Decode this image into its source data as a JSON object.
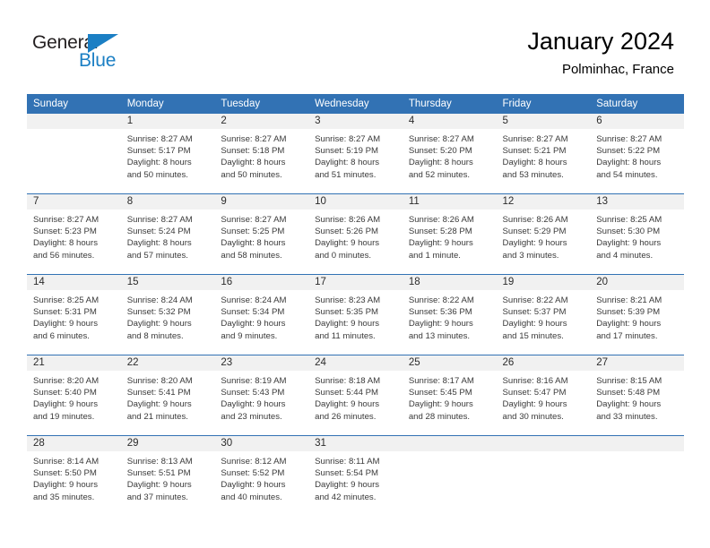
{
  "brand": {
    "name_part1": "General",
    "name_part2": "Blue",
    "accent_color": "#1b7fc4"
  },
  "header": {
    "title": "January 2024",
    "subtitle": "Polminhac, France"
  },
  "calendar": {
    "header_color": "#3272b4",
    "daynum_band_color": "#f1f1f1",
    "weekday_headers": [
      "Sunday",
      "Monday",
      "Tuesday",
      "Wednesday",
      "Thursday",
      "Friday",
      "Saturday"
    ],
    "weeks": [
      [
        {
          "day": "",
          "sunrise": "",
          "sunset": "",
          "daylight_line1": "",
          "daylight_line2": ""
        },
        {
          "day": "1",
          "sunrise": "Sunrise: 8:27 AM",
          "sunset": "Sunset: 5:17 PM",
          "daylight_line1": "Daylight: 8 hours",
          "daylight_line2": "and 50 minutes."
        },
        {
          "day": "2",
          "sunrise": "Sunrise: 8:27 AM",
          "sunset": "Sunset: 5:18 PM",
          "daylight_line1": "Daylight: 8 hours",
          "daylight_line2": "and 50 minutes."
        },
        {
          "day": "3",
          "sunrise": "Sunrise: 8:27 AM",
          "sunset": "Sunset: 5:19 PM",
          "daylight_line1": "Daylight: 8 hours",
          "daylight_line2": "and 51 minutes."
        },
        {
          "day": "4",
          "sunrise": "Sunrise: 8:27 AM",
          "sunset": "Sunset: 5:20 PM",
          "daylight_line1": "Daylight: 8 hours",
          "daylight_line2": "and 52 minutes."
        },
        {
          "day": "5",
          "sunrise": "Sunrise: 8:27 AM",
          "sunset": "Sunset: 5:21 PM",
          "daylight_line1": "Daylight: 8 hours",
          "daylight_line2": "and 53 minutes."
        },
        {
          "day": "6",
          "sunrise": "Sunrise: 8:27 AM",
          "sunset": "Sunset: 5:22 PM",
          "daylight_line1": "Daylight: 8 hours",
          "daylight_line2": "and 54 minutes."
        }
      ],
      [
        {
          "day": "7",
          "sunrise": "Sunrise: 8:27 AM",
          "sunset": "Sunset: 5:23 PM",
          "daylight_line1": "Daylight: 8 hours",
          "daylight_line2": "and 56 minutes."
        },
        {
          "day": "8",
          "sunrise": "Sunrise: 8:27 AM",
          "sunset": "Sunset: 5:24 PM",
          "daylight_line1": "Daylight: 8 hours",
          "daylight_line2": "and 57 minutes."
        },
        {
          "day": "9",
          "sunrise": "Sunrise: 8:27 AM",
          "sunset": "Sunset: 5:25 PM",
          "daylight_line1": "Daylight: 8 hours",
          "daylight_line2": "and 58 minutes."
        },
        {
          "day": "10",
          "sunrise": "Sunrise: 8:26 AM",
          "sunset": "Sunset: 5:26 PM",
          "daylight_line1": "Daylight: 9 hours",
          "daylight_line2": "and 0 minutes."
        },
        {
          "day": "11",
          "sunrise": "Sunrise: 8:26 AM",
          "sunset": "Sunset: 5:28 PM",
          "daylight_line1": "Daylight: 9 hours",
          "daylight_line2": "and 1 minute."
        },
        {
          "day": "12",
          "sunrise": "Sunrise: 8:26 AM",
          "sunset": "Sunset: 5:29 PM",
          "daylight_line1": "Daylight: 9 hours",
          "daylight_line2": "and 3 minutes."
        },
        {
          "day": "13",
          "sunrise": "Sunrise: 8:25 AM",
          "sunset": "Sunset: 5:30 PM",
          "daylight_line1": "Daylight: 9 hours",
          "daylight_line2": "and 4 minutes."
        }
      ],
      [
        {
          "day": "14",
          "sunrise": "Sunrise: 8:25 AM",
          "sunset": "Sunset: 5:31 PM",
          "daylight_line1": "Daylight: 9 hours",
          "daylight_line2": "and 6 minutes."
        },
        {
          "day": "15",
          "sunrise": "Sunrise: 8:24 AM",
          "sunset": "Sunset: 5:32 PM",
          "daylight_line1": "Daylight: 9 hours",
          "daylight_line2": "and 8 minutes."
        },
        {
          "day": "16",
          "sunrise": "Sunrise: 8:24 AM",
          "sunset": "Sunset: 5:34 PM",
          "daylight_line1": "Daylight: 9 hours",
          "daylight_line2": "and 9 minutes."
        },
        {
          "day": "17",
          "sunrise": "Sunrise: 8:23 AM",
          "sunset": "Sunset: 5:35 PM",
          "daylight_line1": "Daylight: 9 hours",
          "daylight_line2": "and 11 minutes."
        },
        {
          "day": "18",
          "sunrise": "Sunrise: 8:22 AM",
          "sunset": "Sunset: 5:36 PM",
          "daylight_line1": "Daylight: 9 hours",
          "daylight_line2": "and 13 minutes."
        },
        {
          "day": "19",
          "sunrise": "Sunrise: 8:22 AM",
          "sunset": "Sunset: 5:37 PM",
          "daylight_line1": "Daylight: 9 hours",
          "daylight_line2": "and 15 minutes."
        },
        {
          "day": "20",
          "sunrise": "Sunrise: 8:21 AM",
          "sunset": "Sunset: 5:39 PM",
          "daylight_line1": "Daylight: 9 hours",
          "daylight_line2": "and 17 minutes."
        }
      ],
      [
        {
          "day": "21",
          "sunrise": "Sunrise: 8:20 AM",
          "sunset": "Sunset: 5:40 PM",
          "daylight_line1": "Daylight: 9 hours",
          "daylight_line2": "and 19 minutes."
        },
        {
          "day": "22",
          "sunrise": "Sunrise: 8:20 AM",
          "sunset": "Sunset: 5:41 PM",
          "daylight_line1": "Daylight: 9 hours",
          "daylight_line2": "and 21 minutes."
        },
        {
          "day": "23",
          "sunrise": "Sunrise: 8:19 AM",
          "sunset": "Sunset: 5:43 PM",
          "daylight_line1": "Daylight: 9 hours",
          "daylight_line2": "and 23 minutes."
        },
        {
          "day": "24",
          "sunrise": "Sunrise: 8:18 AM",
          "sunset": "Sunset: 5:44 PM",
          "daylight_line1": "Daylight: 9 hours",
          "daylight_line2": "and 26 minutes."
        },
        {
          "day": "25",
          "sunrise": "Sunrise: 8:17 AM",
          "sunset": "Sunset: 5:45 PM",
          "daylight_line1": "Daylight: 9 hours",
          "daylight_line2": "and 28 minutes."
        },
        {
          "day": "26",
          "sunrise": "Sunrise: 8:16 AM",
          "sunset": "Sunset: 5:47 PM",
          "daylight_line1": "Daylight: 9 hours",
          "daylight_line2": "and 30 minutes."
        },
        {
          "day": "27",
          "sunrise": "Sunrise: 8:15 AM",
          "sunset": "Sunset: 5:48 PM",
          "daylight_line1": "Daylight: 9 hours",
          "daylight_line2": "and 33 minutes."
        }
      ],
      [
        {
          "day": "28",
          "sunrise": "Sunrise: 8:14 AM",
          "sunset": "Sunset: 5:50 PM",
          "daylight_line1": "Daylight: 9 hours",
          "daylight_line2": "and 35 minutes."
        },
        {
          "day": "29",
          "sunrise": "Sunrise: 8:13 AM",
          "sunset": "Sunset: 5:51 PM",
          "daylight_line1": "Daylight: 9 hours",
          "daylight_line2": "and 37 minutes."
        },
        {
          "day": "30",
          "sunrise": "Sunrise: 8:12 AM",
          "sunset": "Sunset: 5:52 PM",
          "daylight_line1": "Daylight: 9 hours",
          "daylight_line2": "and 40 minutes."
        },
        {
          "day": "31",
          "sunrise": "Sunrise: 8:11 AM",
          "sunset": "Sunset: 5:54 PM",
          "daylight_line1": "Daylight: 9 hours",
          "daylight_line2": "and 42 minutes."
        },
        {
          "day": "",
          "sunrise": "",
          "sunset": "",
          "daylight_line1": "",
          "daylight_line2": ""
        },
        {
          "day": "",
          "sunrise": "",
          "sunset": "",
          "daylight_line1": "",
          "daylight_line2": ""
        },
        {
          "day": "",
          "sunrise": "",
          "sunset": "",
          "daylight_line1": "",
          "daylight_line2": ""
        }
      ]
    ]
  }
}
